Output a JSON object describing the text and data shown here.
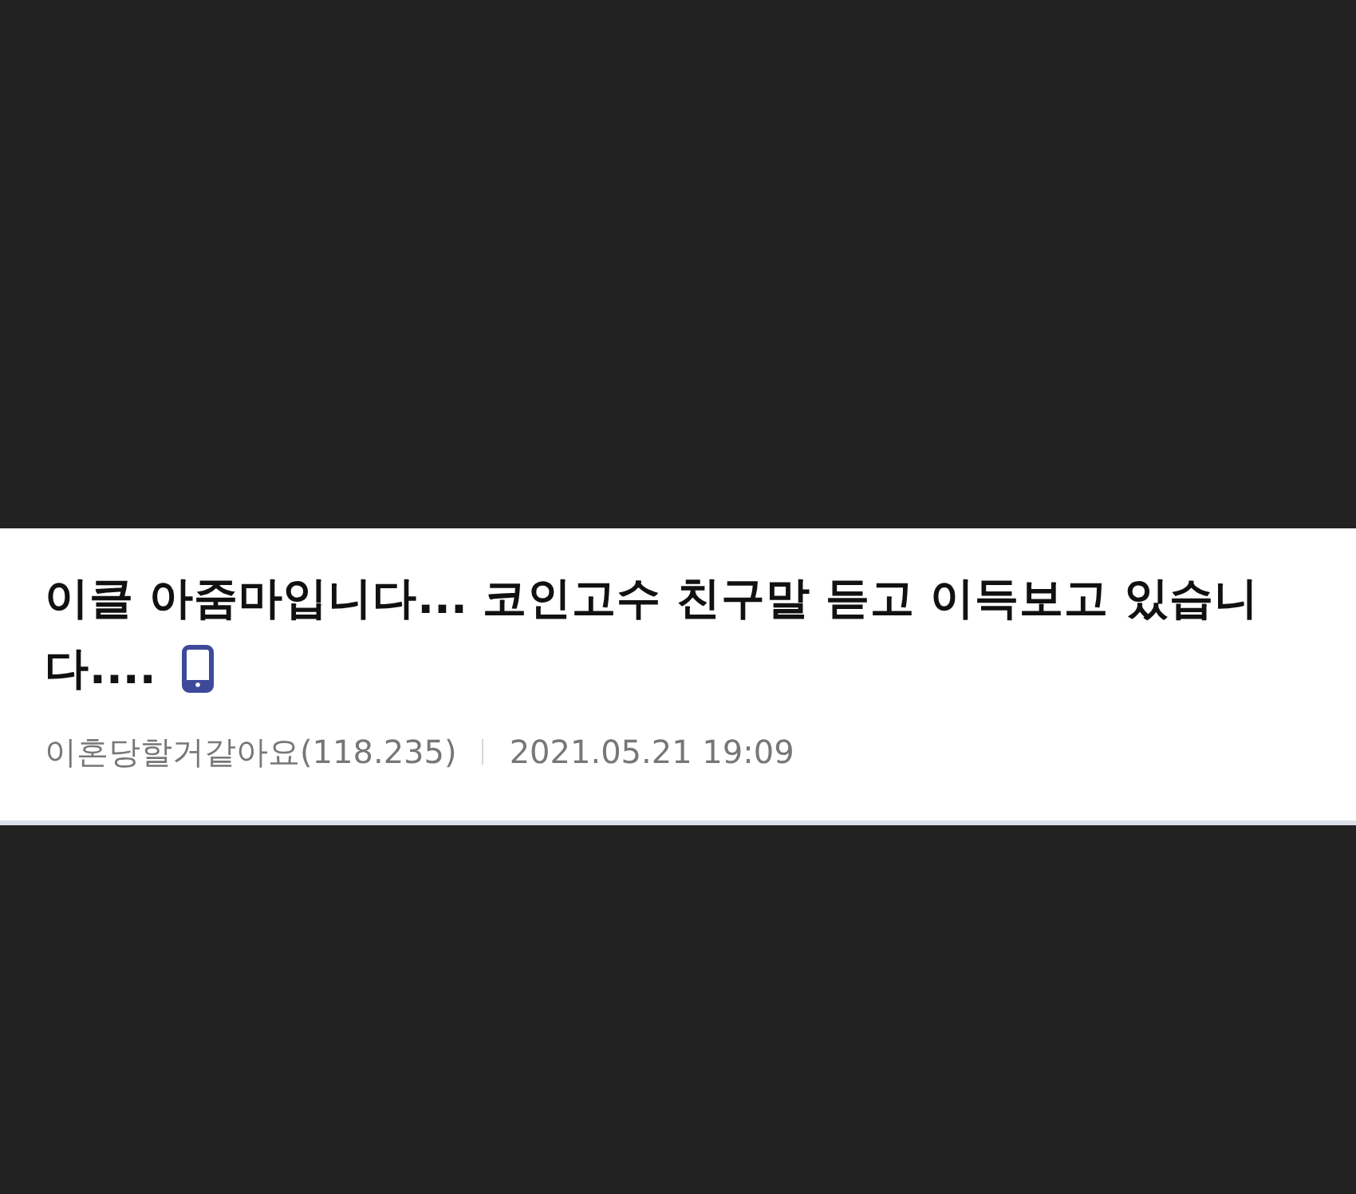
{
  "post": {
    "title": "이클 아줌마입니다... 코인고수 친구말 듣고 이득보고 있습니다....",
    "from_mobile": true,
    "author": "이혼당할거같아요(118.235)",
    "date": "2021.05.21 19:09"
  }
}
